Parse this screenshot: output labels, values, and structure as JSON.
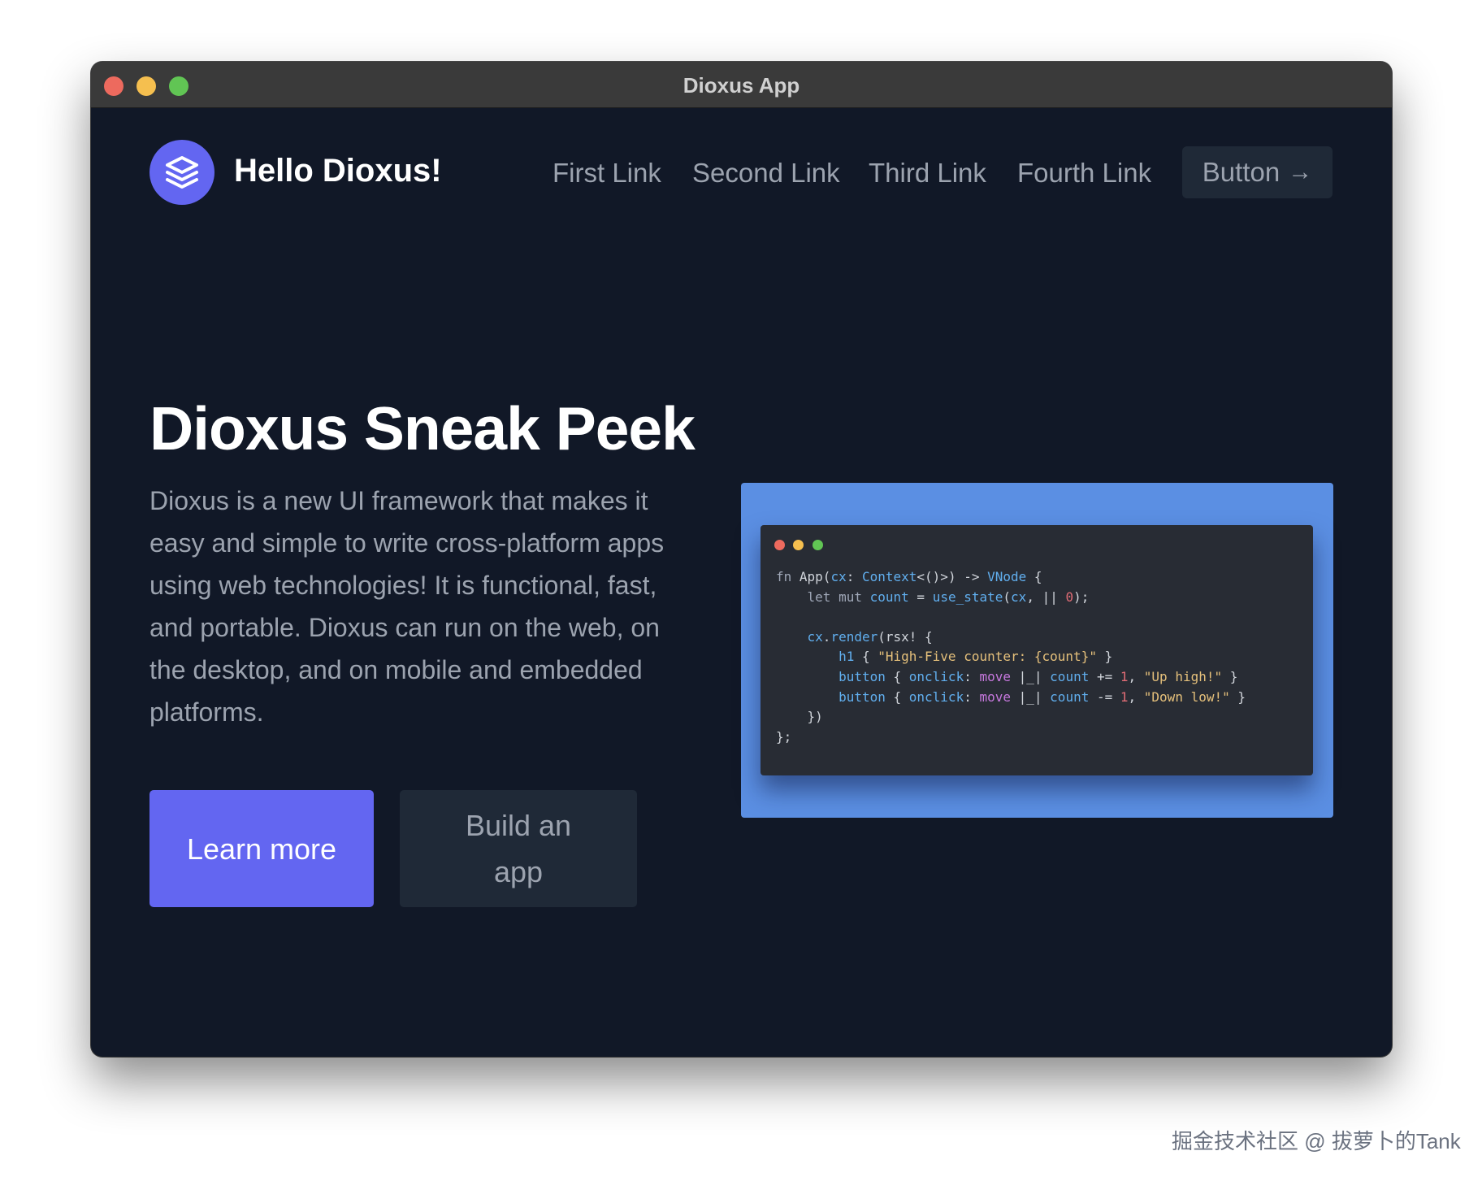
{
  "window": {
    "title": "Dioxus App"
  },
  "header": {
    "brand": "Hello Dioxus!",
    "logo_icon": "layers-icon",
    "nav_links": [
      "First Link",
      "Second Link",
      "Third Link",
      "Fourth Link"
    ],
    "button_label": "Button",
    "button_icon": "arrow-right-icon"
  },
  "hero": {
    "title": "Dioxus Sneak Peek",
    "description": "Dioxus is a new UI framework that makes it easy and simple to write cross-platform apps using web technologies! It is functional, fast, and portable. Dioxus can run on the web, on the desktop, and on mobile and embedded platforms.",
    "primary_button": "Learn more",
    "secondary_button": "Build an app"
  },
  "code_sample": {
    "language": "rust",
    "lines": [
      "fn App(cx: Context<()>) -> VNode {",
      "    let mut count = use_state(cx, || 0);",
      "",
      "    cx.render(rsx! {",
      "        h1 { \"High-Five counter: {count}\" }",
      "        button { onclick: move |_| count += 1, \"Up high!\" }",
      "        button { onclick: move |_| count -= 1, \"Down low!\" }",
      "    })",
      "};"
    ]
  },
  "watermark": "掘金技术社区 @ 拔萝卜的Tank",
  "colors": {
    "background": "#111827",
    "accent": "#6366f1",
    "surface": "#1f2937",
    "muted_text": "#9ca3af",
    "code_frame": "#5b8fe3",
    "code_bg": "#282c34"
  }
}
